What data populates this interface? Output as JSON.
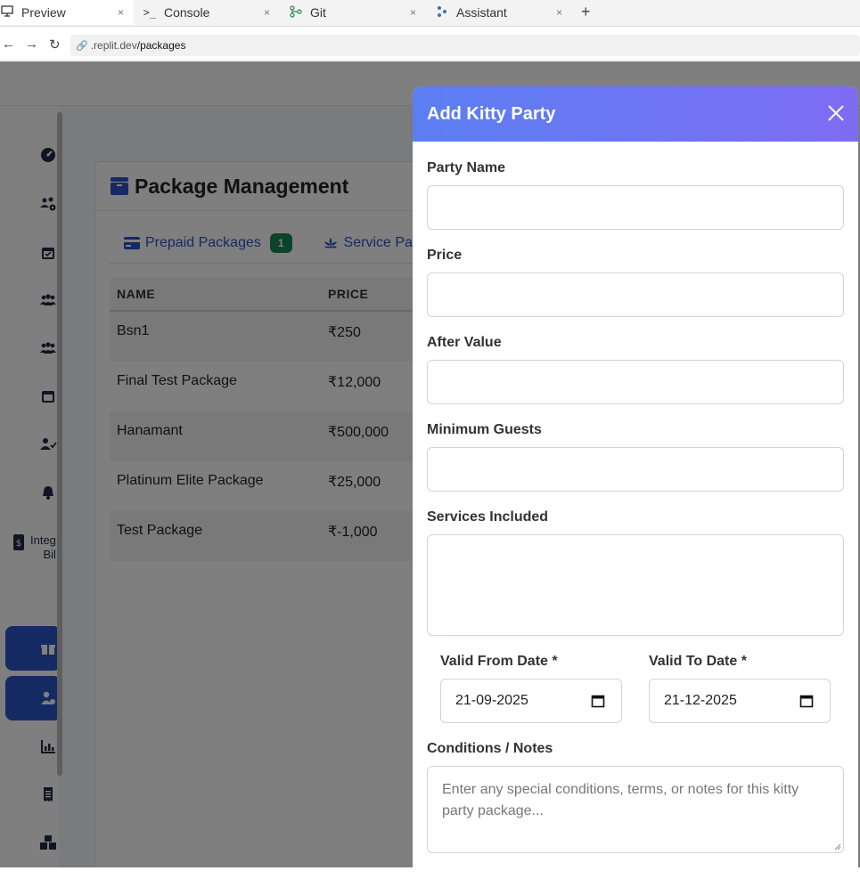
{
  "browser": {
    "tabs": [
      {
        "label": "Preview",
        "icon": "monitor-icon"
      },
      {
        "label": "Console",
        "icon": "terminal-icon"
      },
      {
        "label": "Git",
        "icon": "git-icon"
      },
      {
        "label": "Assistant",
        "icon": "assistant-icon"
      }
    ],
    "close_glyph": "×",
    "new_tab_glyph": "+",
    "url_domain": ".replit.dev",
    "url_path": "/packages"
  },
  "sidebar": {
    "partial_label_line1": "Integ",
    "partial_label_line2": "Bil",
    "icons": [
      "dashboard-icon",
      "users-cog-icon",
      "calendar-check-icon",
      "users-icon",
      "users-icon",
      "calendar-icon",
      "user-check-icon",
      "bell-icon",
      "billing-icon",
      "lotus-icon",
      "gift-icon",
      "user-tag-icon",
      "chart-icon",
      "receipt-icon",
      "boxes-icon"
    ]
  },
  "main": {
    "title": "Package Management",
    "tabs": [
      {
        "label": "Prepaid Packages",
        "badge": "1"
      },
      {
        "label": "Service Pack"
      }
    ],
    "table": {
      "headers": [
        "NAME",
        "PRICE"
      ],
      "rows": [
        {
          "name": "Bsn1",
          "price": "₹250"
        },
        {
          "name": "Final Test Package",
          "price": "₹12,000"
        },
        {
          "name": "Hanamant",
          "price": "₹500,000"
        },
        {
          "name": "Platinum Elite Package",
          "price": "₹25,000"
        },
        {
          "name": "Test Package",
          "price": "₹-1,000"
        }
      ]
    }
  },
  "modal": {
    "title": "Add Kitty Party",
    "fields": {
      "party_name": {
        "label": "Party Name",
        "value": ""
      },
      "price": {
        "label": "Price",
        "value": ""
      },
      "after_value": {
        "label": "After Value",
        "value": ""
      },
      "min_guests": {
        "label": "Minimum Guests",
        "value": ""
      },
      "services": {
        "label": "Services Included",
        "value": ""
      },
      "valid_from": {
        "label": "Valid From Date *",
        "value": "21-09-2025"
      },
      "valid_to": {
        "label": "Valid To Date *",
        "value": "21-12-2025"
      },
      "notes": {
        "label": "Conditions / Notes",
        "placeholder": "Enter any special conditions, terms, or notes for this kitty party package..."
      }
    }
  },
  "colors": {
    "accent": "#2b55c4",
    "badge": "#198754",
    "header_gradient_start": "#5b7ff2",
    "header_gradient_end": "#7e6cf2"
  }
}
